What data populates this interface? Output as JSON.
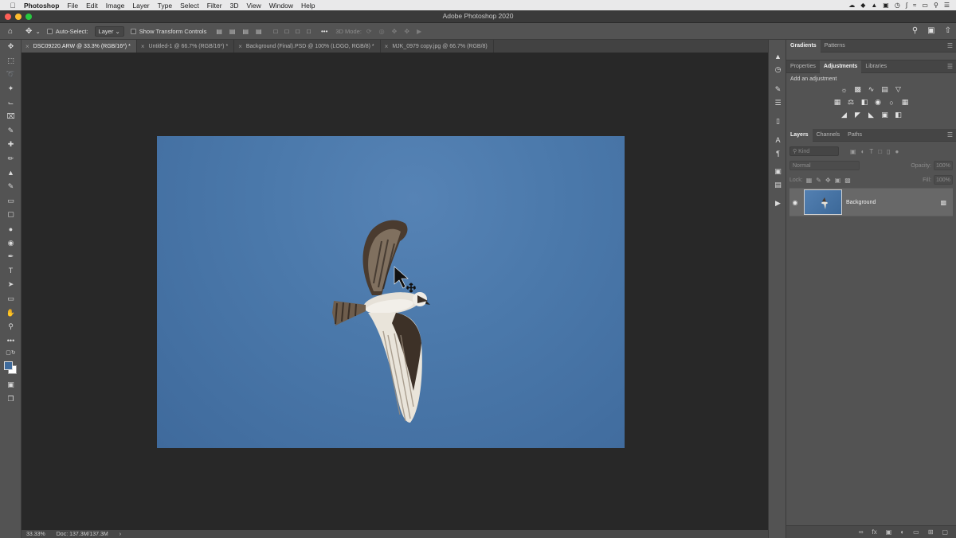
{
  "menubar": {
    "apple_icon": "apple-icon",
    "items": [
      "Photoshop",
      "File",
      "Edit",
      "Image",
      "Layer",
      "Type",
      "Select",
      "Filter",
      "3D",
      "View",
      "Window",
      "Help"
    ]
  },
  "window": {
    "title": "Adobe Photoshop 2020"
  },
  "options": {
    "auto_select_label": "Auto-Select:",
    "auto_select_target": "Layer",
    "show_transform_label": "Show Transform Controls",
    "three_d_mode_label": "3D Mode:"
  },
  "tabs": [
    {
      "label": "DSC09220.ARW @ 33.3% (RGB/16*) *",
      "active": true
    },
    {
      "label": "Untitled-1 @ 66.7% (RGB/16*) *",
      "active": false
    },
    {
      "label": "Background (Final).PSD @ 100% (LOGO, RGB/8) *",
      "active": false
    },
    {
      "label": "MJK_0979 copy.jpg @ 66.7% (RGB/8)",
      "active": false
    }
  ],
  "status": {
    "zoom": "33.33%",
    "doc": "Doc: 137.3M/137.3M",
    "arrow": "›"
  },
  "panels": {
    "top_tabs": [
      "Gradients",
      "Patterns"
    ],
    "mid_tabs": [
      "Properties",
      "Adjustments",
      "Libraries"
    ],
    "adjustments_title": "Add an adjustment",
    "layer_tabs": [
      "Layers",
      "Channels",
      "Paths"
    ],
    "kind_placeholder": "Kind",
    "blend_mode": "Normal",
    "opacity_label": "Opacity:",
    "opacity_value": "100%",
    "lock_label": "Lock:",
    "fill_label": "Fill:",
    "fill_value": "100%",
    "layer_name": "Background"
  },
  "colors": {
    "foreground": "#3f6b9c",
    "background": "#ffffff",
    "sky": "#4b79ab"
  }
}
